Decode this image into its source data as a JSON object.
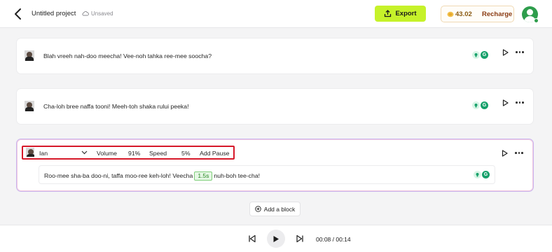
{
  "header": {
    "project_title": "Untitled project",
    "save_status": "Unsaved",
    "export_label": "Export",
    "credits": "43.02",
    "recharge_label": "Recharge"
  },
  "blocks": [
    {
      "text": "Blah vreeh nah-doo meecha! Vee-noh tahka ree-mee soocha?"
    },
    {
      "text": "Cha-loh bree naffa tooni! Meeh-toh shaka rului peeka!"
    },
    {
      "speaker": "Ian",
      "volume_label": "Volume",
      "volume_value": "91%",
      "speed_label": "Speed",
      "speed_value": "5%",
      "add_pause_label": "Add Pause",
      "text_before": "Roo-mee sha-ba doo-ni, taffa moo-ree keh-loh! Veecha",
      "pause": "1.5s",
      "text_after": "nuh-boh tee-cha!"
    }
  ],
  "add_block_label": "Add a block",
  "player": {
    "time": "00:08 / 00:14"
  },
  "colors": {
    "export_accent": "#c6f22a",
    "highlight_box": "#d6192a",
    "brand_green": "#2e9d4c"
  }
}
